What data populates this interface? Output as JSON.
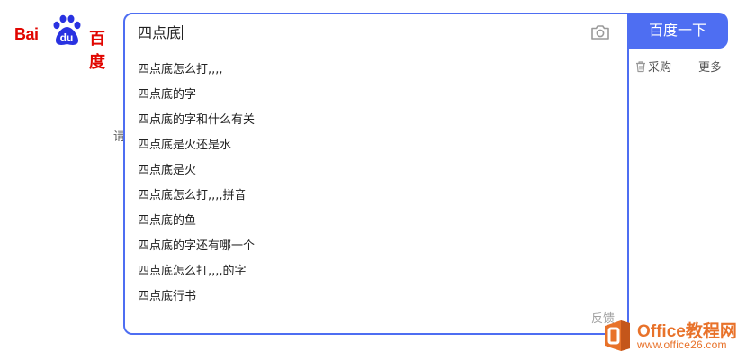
{
  "logo": {
    "latin": "Bai",
    "du": "du",
    "chinese": "百度"
  },
  "search": {
    "query": "四点底",
    "submit_label": "百度一下",
    "camera_icon": "camera-icon",
    "suggestions": [
      "四点底怎么打,,,,",
      "四点底的字",
      "四点底的字和什么有关",
      "四点底是火还是水",
      "四点底是火",
      "四点底怎么打,,,,拼音",
      "四点底的鱼",
      "四点底的字还有哪一个",
      "四点底怎么打,,,,的字",
      "四点底行书"
    ],
    "feedback_label": "反馈"
  },
  "nav": {
    "caigou": "采购",
    "caigou_icon": "trash-bin-icon",
    "more": "更多"
  },
  "left_peek_text": "请",
  "watermark": {
    "brand": "Office教程网",
    "url": "www.office26.com",
    "icon": "office-logo-icon"
  },
  "colors": {
    "accent": "#4e6ef2",
    "logo_red": "#e10601",
    "logo_blue": "#2932e1",
    "watermark_orange": "#e8722a"
  }
}
